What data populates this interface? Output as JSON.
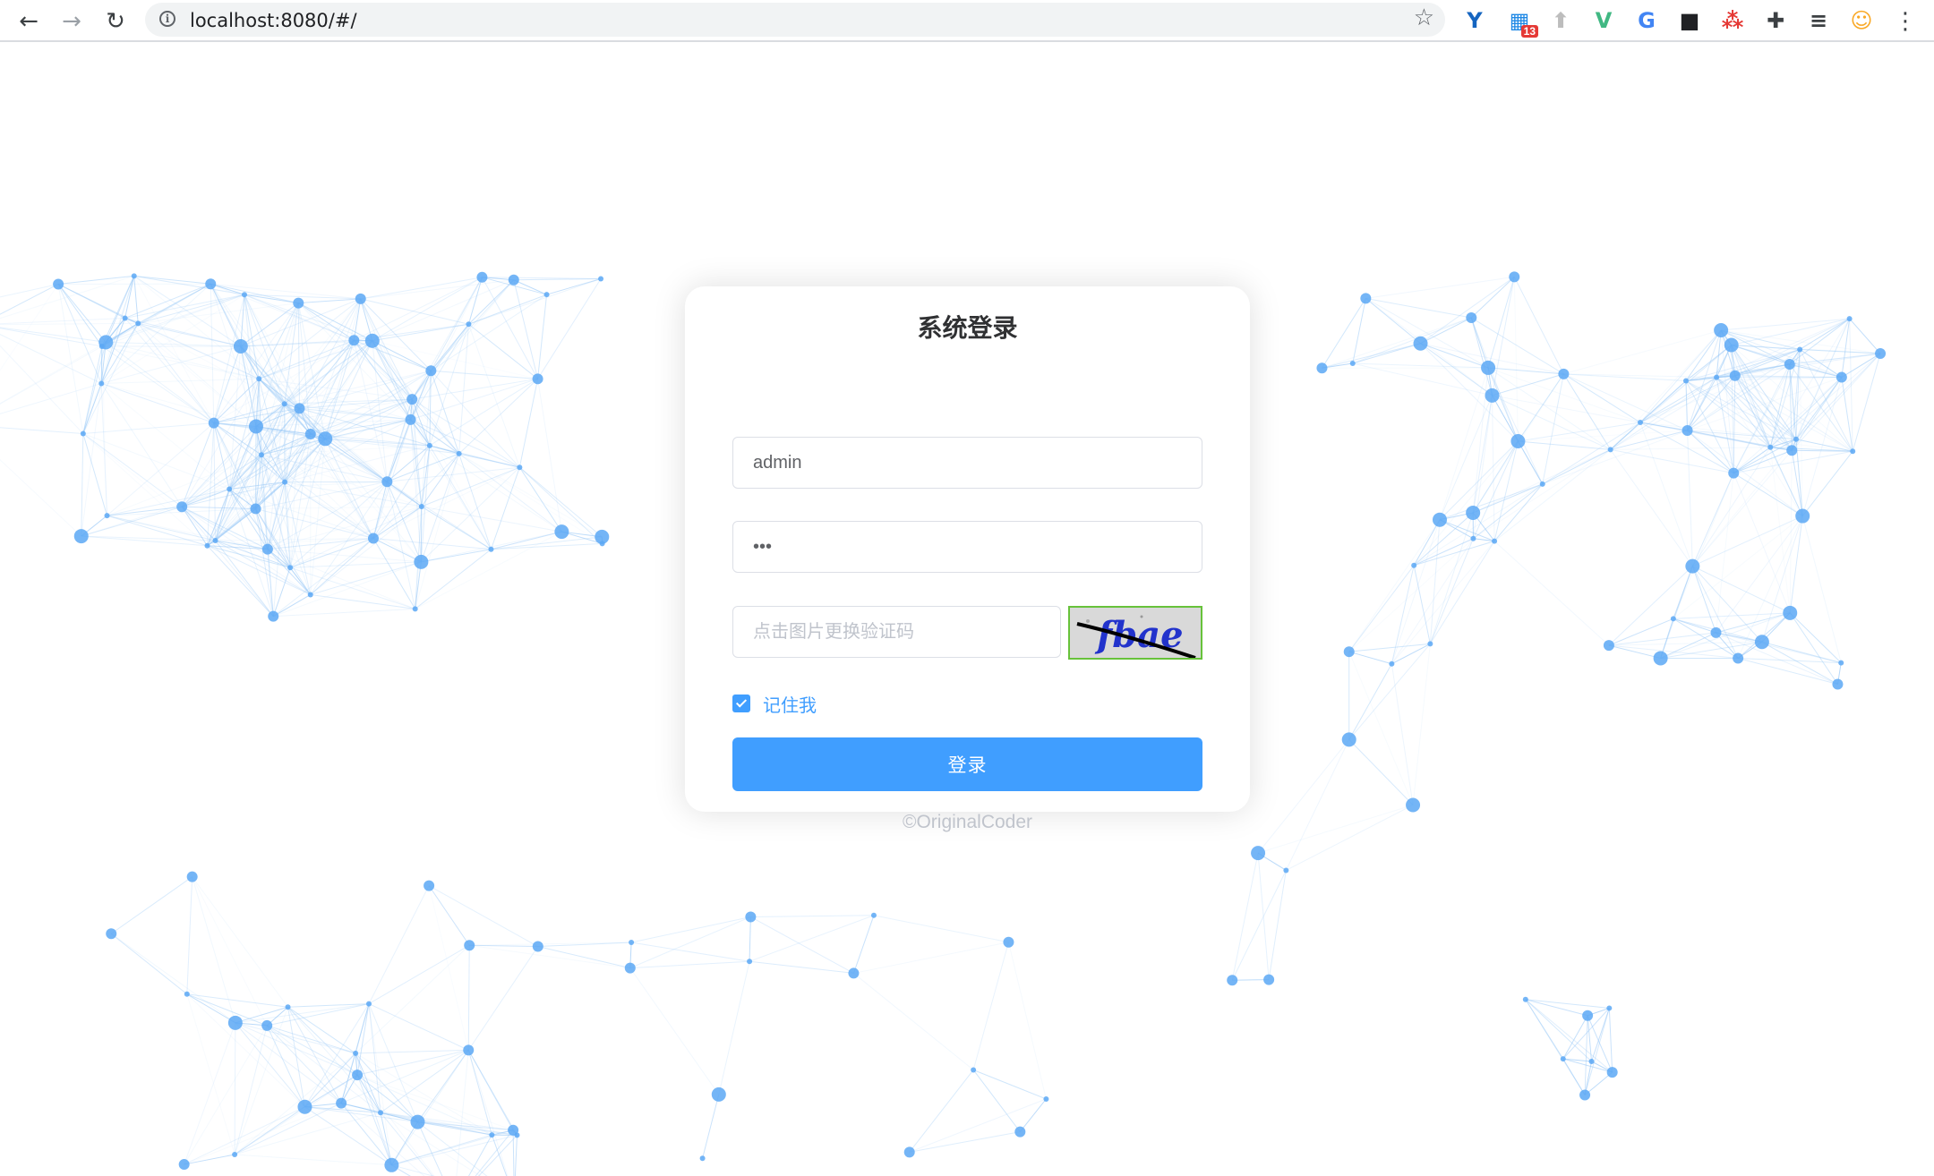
{
  "browser": {
    "back_glyph": "←",
    "forward_glyph": "→",
    "reload_glyph": "↻",
    "url": "localhost:8080/#/",
    "info_glyph": "i",
    "star_glyph": "☆",
    "menu_glyph": "⋮",
    "extensions": [
      {
        "name": "vuetify-extension-icon",
        "glyph": "Y",
        "color": "#1565c0"
      },
      {
        "name": "tabs-extension-icon",
        "glyph": "▦",
        "color": "#1e88e5",
        "badge": "13"
      },
      {
        "name": "upload-extension-icon",
        "glyph": "⬆",
        "color": "#bdbdbd"
      },
      {
        "name": "vue-devtools-icon",
        "glyph": "V",
        "color": "#41b883"
      },
      {
        "name": "translate-extension-icon",
        "glyph": "G",
        "color": "#4285f4"
      },
      {
        "name": "dark-extension-icon",
        "glyph": "■",
        "color": "#202124"
      },
      {
        "name": "network-extension-icon",
        "glyph": "⁂",
        "color": "#e53935"
      },
      {
        "name": "puzzle-extensions-icon",
        "glyph": "✚",
        "color": "#3c4043"
      },
      {
        "name": "reading-list-icon",
        "glyph": "≡",
        "color": "#3c4043"
      },
      {
        "name": "profile-avatar-icon",
        "glyph": "☺",
        "color": "#f9a825"
      }
    ]
  },
  "login": {
    "title": "系统登录",
    "username_value": "admin",
    "password_value": "•••",
    "captcha_placeholder": "点击图片更换验证码",
    "captcha_text": "fbae",
    "remember_label": "记住我",
    "remember_checked": true,
    "submit_label": "登录",
    "footer": "©OriginalCoder"
  },
  "colors": {
    "primary": "#409eff",
    "network_node": "#5ca8f5",
    "network_line": "#9ecbf7",
    "captcha_border": "#67c23a"
  }
}
